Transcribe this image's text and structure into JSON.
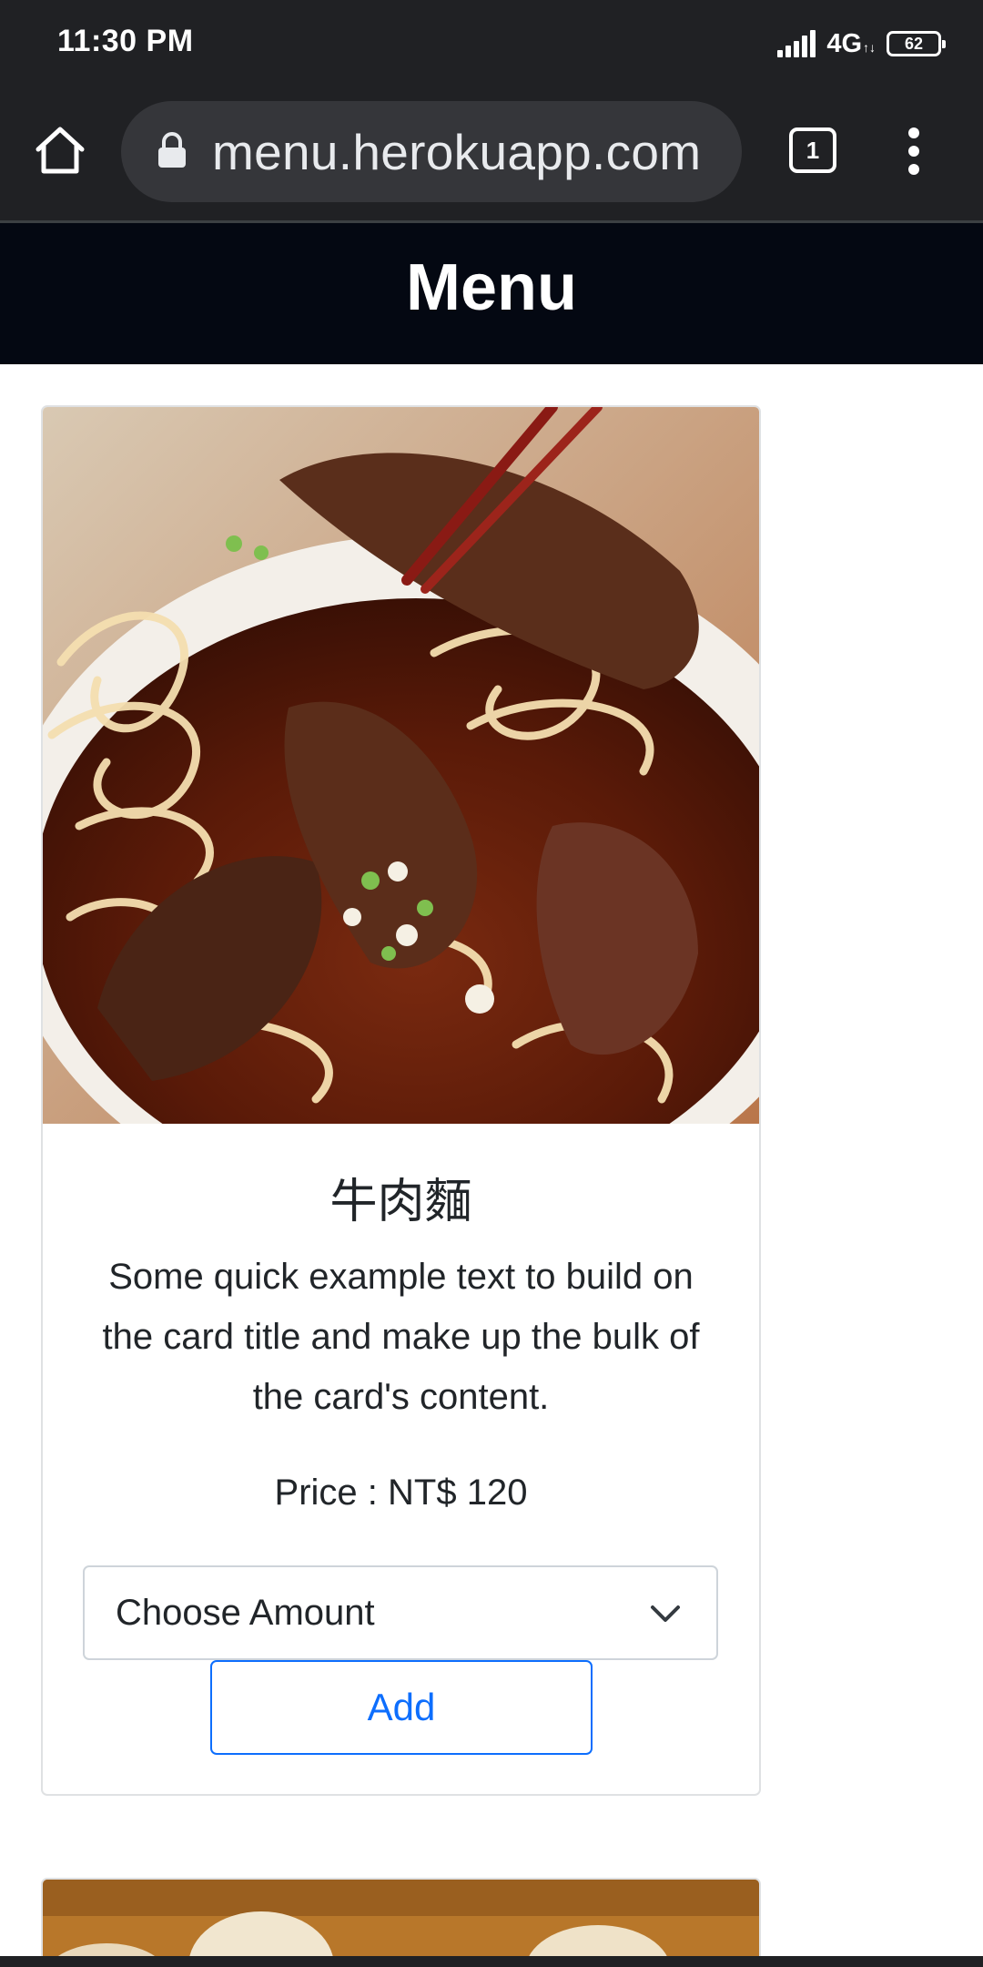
{
  "status_bar": {
    "time": "11:30 PM",
    "network": "4G",
    "network_sub": "↑↓",
    "battery": "62"
  },
  "browser": {
    "url": "menu.herokuapp.com",
    "tab_count": "1"
  },
  "page": {
    "title": "Menu"
  },
  "cards": [
    {
      "title": "牛肉麵",
      "text": "Some quick example text to build on the card title and make up the bulk of the card's content.",
      "price": "Price : NT$ 120",
      "select_placeholder": "Choose Amount",
      "add_label": "Add"
    }
  ],
  "colors": {
    "toolbar_bg": "#202124",
    "navbar_bg": "#040812",
    "primary": "#0d6efd"
  }
}
